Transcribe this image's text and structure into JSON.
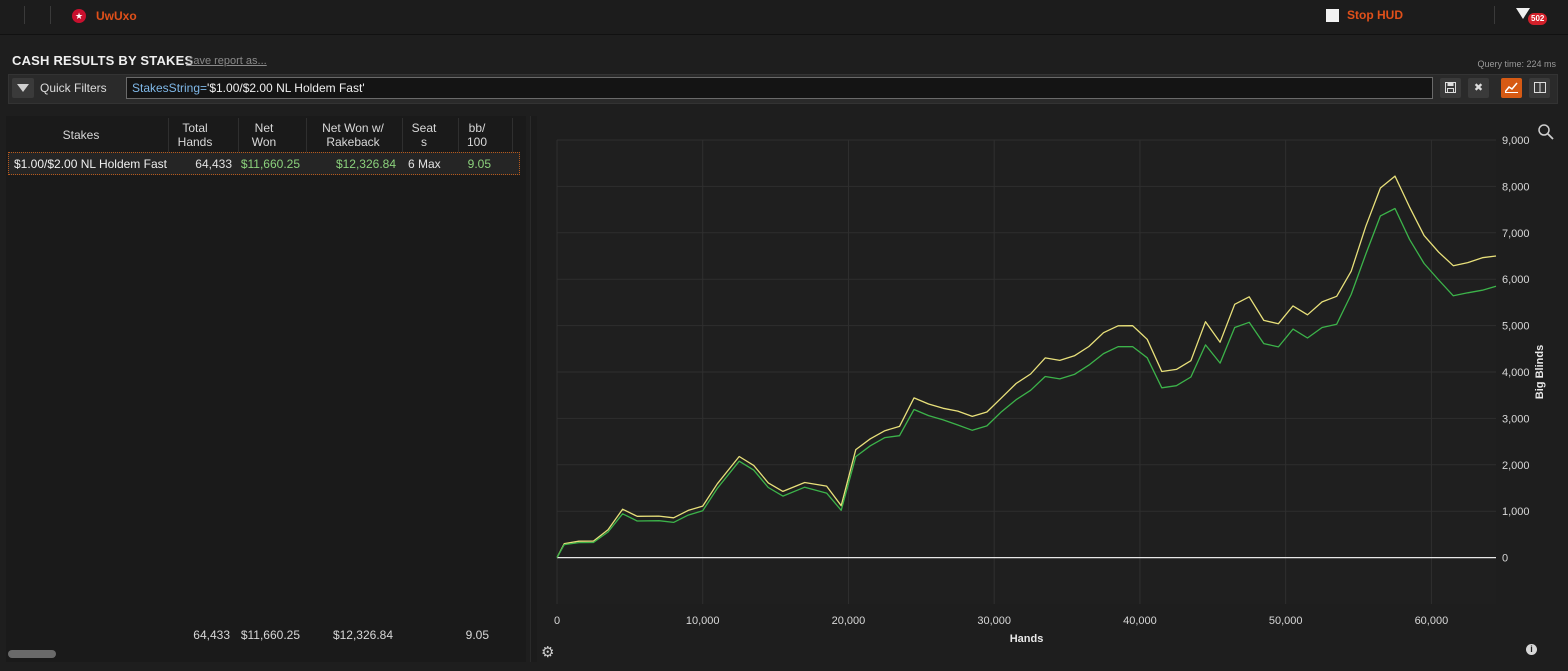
{
  "topbar": {
    "player_name": "UwUxo",
    "stop_hud_label": "Stop HUD",
    "notification_count": "502"
  },
  "report": {
    "title": "CASH RESULTS BY STAKES",
    "save_link": "Save report as...",
    "query_time": "Query time: 224 ms"
  },
  "quick_filters": {
    "label": "Quick Filters",
    "filter_key": "StakesString=",
    "filter_value": "'$1.00/$2.00 NL Holdem Fast'"
  },
  "table": {
    "columns": [
      {
        "l1": "Stakes",
        "l2": ""
      },
      {
        "l1": "Total",
        "l2": "Hands"
      },
      {
        "l1": "Net",
        "l2": "Won"
      },
      {
        "l1": "Net Won w/",
        "l2": "Rakeback"
      },
      {
        "l1": "Seat",
        "l2": "s"
      },
      {
        "l1": "bb/",
        "l2": "100"
      }
    ],
    "rows": [
      {
        "stakes": "$1.00/$2.00 NL Holdem Fast",
        "hands": "64,433",
        "net_won": "$11,660.25",
        "net_won_rb": "$12,326.84",
        "seats": "6 Max",
        "bb100": "9.05"
      }
    ],
    "totals": {
      "hands": "64,433",
      "net_won": "$11,660.25",
      "net_won_rb": "$12,326.84",
      "bb100": "9.05"
    }
  },
  "chart_data": {
    "type": "line",
    "xlabel": "Hands",
    "ylabel": "Big Blinds",
    "xlim": [
      0,
      64433
    ],
    "ylim": [
      -1000,
      9000
    ],
    "x_ticks": [
      "0",
      "10,000",
      "20,000",
      "30,000",
      "40,000",
      "50,000",
      "60,000"
    ],
    "y_ticks": [
      "0",
      "1,000",
      "2,000",
      "3,000",
      "4,000",
      "5,000",
      "6,000",
      "7,000",
      "8,000",
      "9,000"
    ],
    "grid": true,
    "colors": {
      "rakeback": "#e8e07a",
      "net": "#3cb34a",
      "zero": "#e8e8e8"
    },
    "series": [
      {
        "x": [
          0,
          500,
          1500,
          2500,
          3500,
          4500,
          5500,
          7000,
          8000,
          9000,
          10000,
          11000,
          12500,
          13500,
          14500,
          15500,
          17000,
          18500,
          19500,
          20500,
          21500,
          22500,
          23500,
          24500,
          25500,
          26500,
          27500,
          28500,
          29500,
          30500,
          31500,
          32500,
          33500,
          34500,
          35500,
          36500,
          37500,
          38500,
          39500,
          40500,
          41500,
          42500,
          43500,
          44500,
          45500,
          46500,
          47500,
          48500,
          49500,
          50500,
          51500,
          52500,
          53500,
          54500,
          55500,
          56500,
          57500,
          58500,
          59500,
          60500,
          61500,
          62500,
          63500,
          64433
        ],
        "values": [
          0,
          250,
          300,
          350,
          650,
          1100,
          900,
          850,
          800,
          1000,
          1150,
          1650,
          2200,
          1950,
          1550,
          1400,
          1650,
          1600,
          1150,
          2300,
          2500,
          2700,
          2850,
          3500,
          3350,
          3200,
          3100,
          3000,
          3150,
          3500,
          3800,
          3950,
          4250,
          4200,
          4350,
          4600,
          4900,
          5000,
          4950,
          4650,
          4000,
          4100,
          4300,
          5100,
          4600,
          5400,
          5600,
          5150,
          5100,
          5450,
          5200,
          5450,
          5600,
          6200,
          7200,
          8000,
          8200,
          7500,
          6900,
          6600,
          6350,
          6400,
          6450,
          6500
        ]
      },
      {
        "x": [
          0,
          500,
          1500,
          2500,
          3500,
          4500,
          5500,
          7000,
          8000,
          9000,
          10000,
          11000,
          12500,
          13500,
          14500,
          15500,
          17000,
          18500,
          19500,
          20500,
          21500,
          22500,
          23500,
          24500,
          25500,
          26500,
          27500,
          28500,
          29500,
          30500,
          31500,
          32500,
          33500,
          34500,
          35500,
          36500,
          37500,
          38500,
          39500,
          40500,
          41500,
          42500,
          43500,
          44500,
          45500,
          46500,
          47500,
          48500,
          49500,
          50500,
          51500,
          52500,
          53500,
          54500,
          55500,
          56500,
          57500,
          58500,
          59500,
          60500,
          61500,
          62500,
          63500,
          64433
        ],
        "values": [
          0,
          230,
          270,
          320,
          600,
          1000,
          800,
          750,
          700,
          900,
          1050,
          1550,
          2100,
          1850,
          1450,
          1300,
          1550,
          1450,
          1050,
          2150,
          2350,
          2550,
          2650,
          3250,
          3100,
          2950,
          2800,
          2700,
          2850,
          3200,
          3450,
          3600,
          3850,
          3800,
          3950,
          4200,
          4450,
          4550,
          4500,
          4250,
          3650,
          3750,
          3950,
          4600,
          4150,
          4900,
          5050,
          4650,
          4600,
          4950,
          4700,
          4900,
          5000,
          5700,
          6600,
          7400,
          7500,
          6800,
          6300,
          6000,
          5700,
          5750,
          5750,
          5850
        ]
      }
    ]
  }
}
